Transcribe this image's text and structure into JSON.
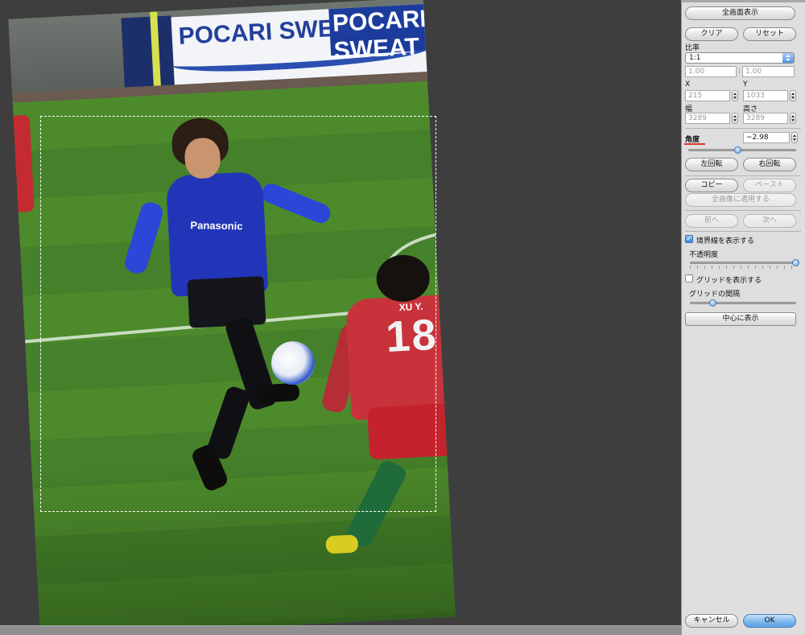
{
  "canvas": {
    "photo": {
      "ad_text": "POCARI SWEAT",
      "ad_text_alt": "POCARI SWEAT",
      "player_sponsor": "Panasonic",
      "opponent_name": "XU Y.",
      "opponent_number": "18"
    }
  },
  "panel": {
    "fullscreen_label": "全画面表示",
    "clear_label": "クリア",
    "reset_label": "リセット",
    "ratio_label": "比率",
    "ratio_value": "1:1",
    "ratio_w": "1.00",
    "ratio_separator": ":",
    "ratio_h": "1.00",
    "x_label": "X",
    "x_value": "215",
    "y_label": "Y",
    "y_value": "1033",
    "width_label": "幅",
    "width_value": "3289",
    "height_label": "高さ",
    "height_value": "3289",
    "angle_label": "角度",
    "angle_value": "−2.98",
    "angle_slider_fraction": 0.46,
    "rotate_left_label": "左回転",
    "rotate_right_label": "右回転",
    "copy_label": "コピー",
    "paste_label": "ペースト",
    "apply_all_label": "全画像に適用する",
    "prev_label": "前へ",
    "next_label": "次へ",
    "show_border_label": "境界線を表示する",
    "show_border_checked": true,
    "opacity_label": "不透明度",
    "opacity_fraction": 1.0,
    "show_grid_label": "グリッドを表示する",
    "show_grid_checked": false,
    "grid_spacing_label": "グリッドの間隔",
    "grid_spacing_fraction": 0.22,
    "center_label": "中心に表示",
    "cancel_label": "キャンセル",
    "ok_label": "OK"
  },
  "colors": {
    "accent": "#5d9fe4",
    "angle_marker": "#d83a2a"
  }
}
